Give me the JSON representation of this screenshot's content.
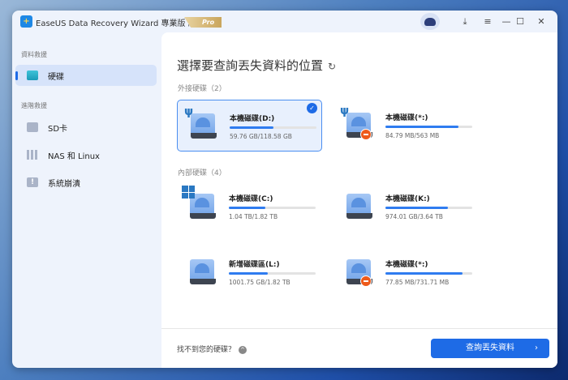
{
  "app": {
    "title": "EaseUS Data Recovery Wizard 專業版 終身",
    "badge": "Pro"
  },
  "sidebar": {
    "section1": "資料救援",
    "section2": "進階救援",
    "items": [
      {
        "label": "硬碟",
        "active": true
      },
      {
        "label": "SD卡"
      },
      {
        "label": "NAS 和 Linux"
      },
      {
        "label": "系統崩潰"
      }
    ]
  },
  "main": {
    "heading": "選擇要查詢丟失資料的位置",
    "external": {
      "label": "外接硬碟（2）",
      "disks": [
        {
          "name": "本機磁碟(D:)",
          "size": "59.76 GB/118.58 GB",
          "fill": 0.5,
          "selected": true
        },
        {
          "name": "本機磁碟(*:)",
          "size": "84.79 MB/563 MB",
          "fill": 0.84
        }
      ]
    },
    "internal": {
      "label": "內部硬碟（4）",
      "disks": [
        {
          "name": "本機磁碟(C:)",
          "size": "1.04 TB/1.82 TB",
          "fill": 0.42
        },
        {
          "name": "本機磁碟(K:)",
          "size": "974.01 GB/3.64 TB",
          "fill": 0.72
        },
        {
          "name": "新增磁碟區(L:)",
          "size": "1001.75 GB/1.82 TB",
          "fill": 0.45
        },
        {
          "name": "本機磁碟(*:)",
          "size": "77.85 MB/731.71 MB",
          "fill": 0.89
        }
      ]
    },
    "cant_find": "找不到您的硬碟？",
    "scan_button": "查詢丟失資料"
  },
  "colors": {
    "accent": "#1e6be6",
    "error": "#ee5a1a"
  }
}
